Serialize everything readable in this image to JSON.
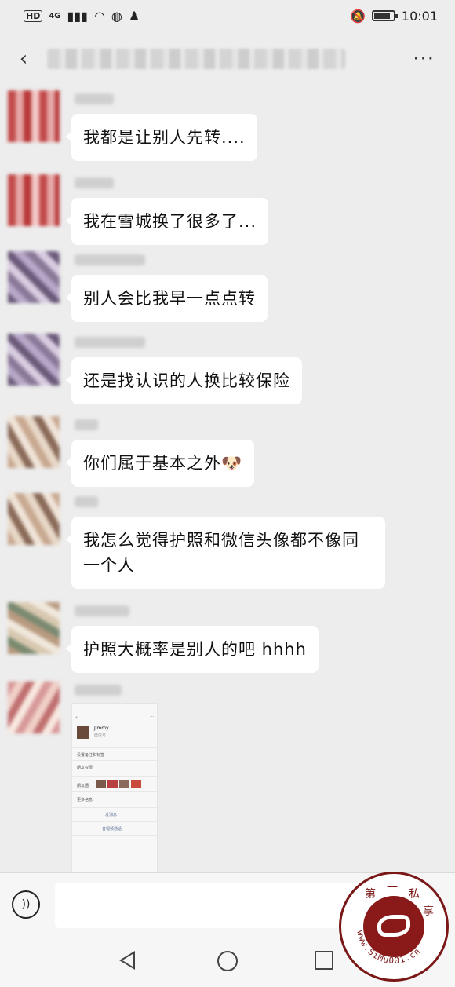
{
  "status_bar": {
    "hd": "HD",
    "network": "4G",
    "time": "10:01",
    "battery_level": 0.85
  },
  "chat": {
    "messages": [
      {
        "avatar": "av-red",
        "text": "我都是让别人先转...."
      },
      {
        "avatar": "av-red",
        "text": "我在雪城换了很多了..."
      },
      {
        "avatar": "av-purple",
        "text": "别人会比我早一点点转"
      },
      {
        "avatar": "av-purple",
        "text": "还是找认识的人换比较保险"
      },
      {
        "avatar": "av-face",
        "text": "你们属于基本之外🐶"
      },
      {
        "avatar": "av-face",
        "text": "我怎么觉得护照和微信头像都不像同一个人"
      },
      {
        "avatar": "av-mix",
        "text": "护照大概率是别人的吧 hhhh"
      }
    ],
    "shared_image": {
      "profile_name": "Jimmy",
      "wechat_id_label": "微信号：",
      "item_remark": "设置备注和标签",
      "item_perm": "朋友权限",
      "item_moments": "朋友圈",
      "item_more": "更多信息",
      "btn_message": "发消息",
      "btn_call": "音视频通话"
    }
  },
  "watermark": {
    "chars": [
      "第",
      "一",
      "私",
      "享"
    ],
    "url": "www.SiMu001.cn"
  }
}
